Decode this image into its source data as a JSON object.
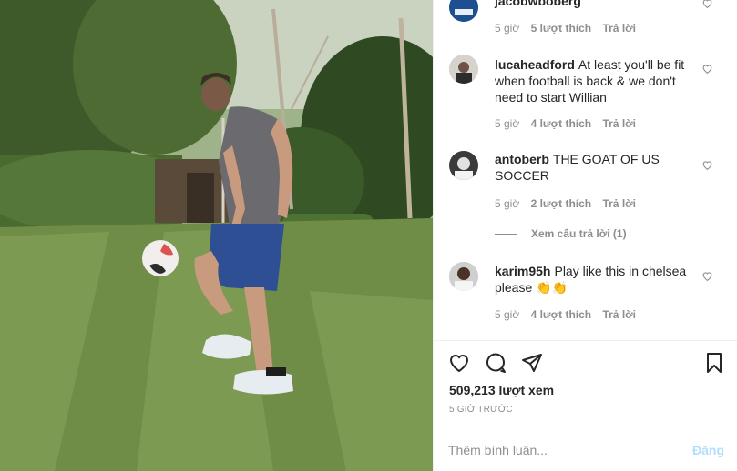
{
  "comments": [
    {
      "username": "jacobwboberg",
      "text": "",
      "time": "5 giờ",
      "likes": "5 lượt thích",
      "reply": "Trả lời",
      "avatar": "avatar-blue-logo"
    },
    {
      "username": "lucaheadford",
      "text": "At least you'll be fit when football is back & we don't need to start Willian",
      "time": "5 giờ",
      "likes": "4 lượt thích",
      "reply": "Trả lời",
      "avatar": "avatar-photo"
    },
    {
      "username": "antoberb",
      "text": "THE GOAT OF US SOCCER",
      "time": "5 giờ",
      "likes": "2 lượt thích",
      "reply": "Trả lời",
      "avatar": "avatar-photo"
    },
    {
      "username": "karim95h",
      "text": "Play like this in chelsea please 👏👏",
      "time": "5 giờ",
      "likes": "4 lượt thích",
      "reply": "Trả lời",
      "avatar": "avatar-photo"
    }
  ],
  "view_replies": "Xem câu trả lời (1)",
  "actions": {
    "icons": [
      "heart-icon",
      "comment-icon",
      "share-icon",
      "bookmark-icon"
    ]
  },
  "views": "509,213 lượt xem",
  "posted_ago": "5 GIỜ TRƯỚC",
  "add_comment": {
    "placeholder": "Thêm bình luận...",
    "post_label": "Đăng"
  },
  "colors": {
    "muted": "#8e8e8e",
    "text": "#262626",
    "post_disabled": "#b2dffc"
  }
}
